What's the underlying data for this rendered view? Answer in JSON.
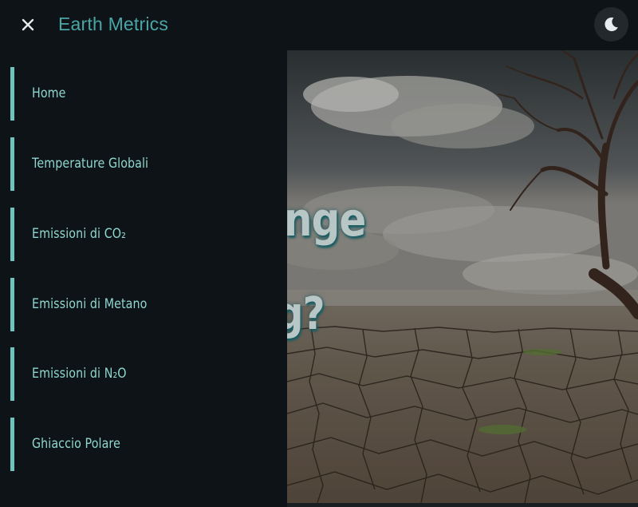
{
  "header": {
    "brand": "Earth Metrics",
    "close_icon": "close-icon",
    "theme_icon": "moon-icon"
  },
  "nav": {
    "items": [
      {
        "label": "Home"
      },
      {
        "label": "Temperature Globali"
      },
      {
        "label": "Emissioni di CO₂"
      },
      {
        "label": "Emissioni di Metano"
      },
      {
        "label": "Emissioni di N₂O"
      },
      {
        "label": "Ghiaccio Polare"
      }
    ]
  },
  "hero": {
    "title_fragment": "nge",
    "subtitle_fragment": "g?"
  },
  "colors": {
    "accent": "#4aa6a6",
    "nav_text": "#8fd6d0",
    "nav_bar": "#6fc3bd",
    "background": "#0d1316"
  }
}
